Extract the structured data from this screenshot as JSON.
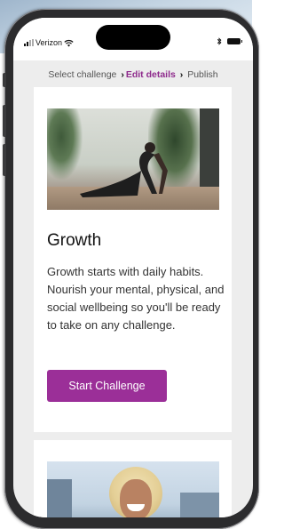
{
  "status_bar": {
    "carrier": "Verizon",
    "icons": [
      "signal-icon",
      "wifi-icon",
      "bluetooth-icon",
      "battery-icon"
    ]
  },
  "breadcrumb": {
    "steps": [
      "Select challenge",
      "Edit details",
      "Publish"
    ],
    "active_index": 1,
    "separator_icon": "chevron-right-icon"
  },
  "card": {
    "image_alt": "yoga-pose-photo",
    "title": "Growth",
    "description": "Growth starts with daily habits. Nourish your mental, physical, and social wellbeing so you'll be ready to take on any challenge.",
    "button_label": "Start Challenge"
  },
  "card2": {
    "image_alt": "smiling-woman-photo"
  },
  "colors": {
    "accent": "#9b2f98",
    "breadcrumb_active": "#8e2a8c",
    "screen_bg": "#ededed"
  }
}
